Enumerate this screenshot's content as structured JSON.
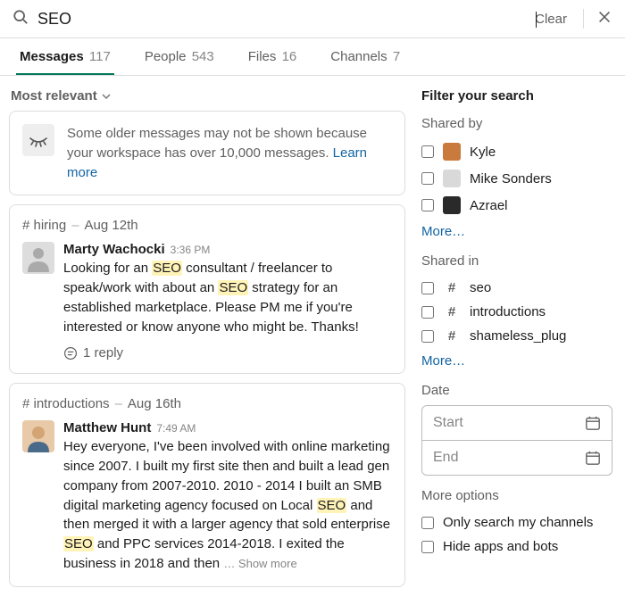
{
  "search": {
    "value": "SEO",
    "clear": "Clear"
  },
  "tabs": [
    {
      "label": "Messages",
      "count": "117"
    },
    {
      "label": "People",
      "count": "543"
    },
    {
      "label": "Files",
      "count": "16"
    },
    {
      "label": "Channels",
      "count": "7"
    }
  ],
  "sort": "Most relevant",
  "notice": {
    "text": "Some older messages may not be shown because your workspace has over 10,000 messages. ",
    "link": "Learn more"
  },
  "messages": [
    {
      "channel": "# hiring",
      "date": "Aug 12th",
      "author": "Marty Wachocki",
      "time": "3:36 PM",
      "pre1": "Looking for an ",
      "hl1": "SEO",
      "mid1": " consultant / freelancer to speak/work with about an ",
      "hl2": "SEO",
      "post1": " strategy for an established marketplace. Please PM me if you're interested or know anyone who might be. Thanks!",
      "replies": "1 reply",
      "avatar_type": "default"
    },
    {
      "channel": "# introductions",
      "date": "Aug 16th",
      "author": "Matthew Hunt",
      "time": "7:49 AM",
      "pre1": "Hey everyone, I've been involved with online marketing since 2007.  I built my first site then and built a lead gen company from 2007-2010.  2010 - 2014 I built an SMB digital marketing agency focused on Local ",
      "hl1": "SEO",
      "mid1": " and then merged it with a larger agency that sold enterprise ",
      "hl2": "SEO",
      "post1": " and PPC services 2014-2018. I exited the business in 2018 and then ",
      "showmore": "… Show more",
      "avatar_type": "photo"
    }
  ],
  "filter": {
    "title": "Filter your search",
    "shared_by_label": "Shared by",
    "shared_by": [
      {
        "name": "Kyle",
        "color": "#c97a3d"
      },
      {
        "name": "Mike Sonders",
        "color": "#d9d9d9"
      },
      {
        "name": "Azrael",
        "color": "#2a2a2a"
      }
    ],
    "shared_in_label": "Shared in",
    "shared_in": [
      "seo",
      "introductions",
      "shameless_plug"
    ],
    "more": "More…",
    "date_label": "Date",
    "date_start": "Start",
    "date_end": "End",
    "more_options_label": "More options",
    "opt_my_channels": "Only search my channels",
    "opt_hide_bots": "Hide apps and bots"
  }
}
